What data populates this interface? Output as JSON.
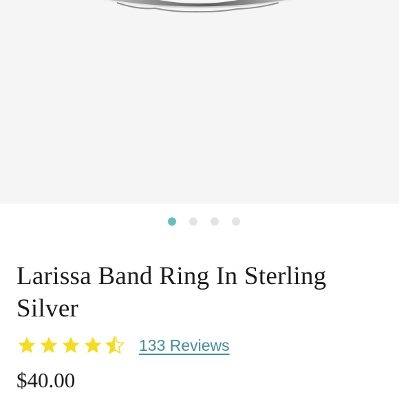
{
  "product": {
    "title": "Larissa Band Ring In Sterling Silver",
    "price": "$40.00",
    "rating": {
      "value": 4.5,
      "max": 5,
      "star_color": "#f5dc1f",
      "reviews_label": "133 Reviews"
    }
  },
  "gallery": {
    "image_count": 4,
    "active_index": 0,
    "active_dot_color": "#62c1bd",
    "inactive_dot_color": "#e4e4e4",
    "image_subject": "sterling silver band ring"
  }
}
